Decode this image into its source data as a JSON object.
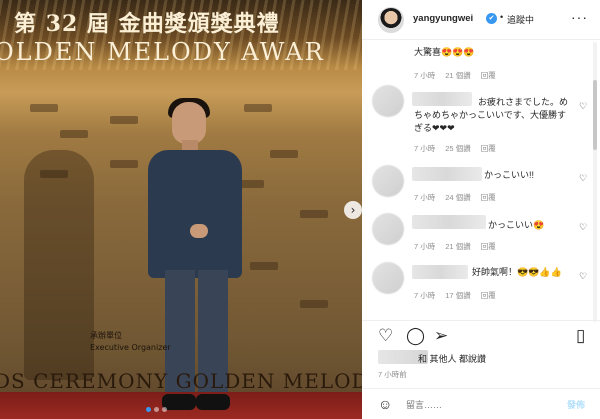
{
  "photo": {
    "title_line1": "第 32 屆 金曲獎頒獎典禮",
    "title_line2": "OLDEN MELODY AWAR",
    "bottom_text": "DS CEREMONY GOLDEN MELOD",
    "organizer_label": "承辦單位\nExecutive Organizer",
    "next_icon": "chevron-right-icon",
    "next_symbol": "›"
  },
  "header": {
    "username": "yangyungwei",
    "verified_symbol": "✔",
    "separator": "•",
    "follow_status": "追蹤中",
    "more_symbol": "···"
  },
  "comments": [
    {
      "text": "大驚喜😍😍😍",
      "time": "7 小時",
      "likes": "21 個讚",
      "reply": "回覆",
      "heart": "♡"
    },
    {
      "text": "お疲れさまでした。めちゃめちゃかっこいいです、大優勝すぎる❤❤❤",
      "time": "7 小時",
      "likes": "25 個讚",
      "reply": "回覆",
      "heart": "♡"
    },
    {
      "text": "かっこいい!!",
      "time": "7 小時",
      "likes": "24 個讚",
      "reply": "回覆",
      "heart": "♡"
    },
    {
      "text": "かっこいい😍",
      "time": "7 小時",
      "likes": "21 個讚",
      "reply": "回覆",
      "heart": "♡"
    },
    {
      "text": "好帥氣啊！😎😎👍👍",
      "time": "7 小時",
      "likes": "17 個讚",
      "reply": "回覆",
      "heart": "♡"
    }
  ],
  "actions": {
    "like_symbol": "♡",
    "comment_symbol": "◯",
    "share_symbol": "➢",
    "save_symbol": "▯"
  },
  "likes": {
    "text": "和 其他人 都說讚"
  },
  "timestamp": "7 小時前",
  "composer": {
    "emoji_symbol": "☺",
    "placeholder": "留言……",
    "post_label": "發佈"
  }
}
